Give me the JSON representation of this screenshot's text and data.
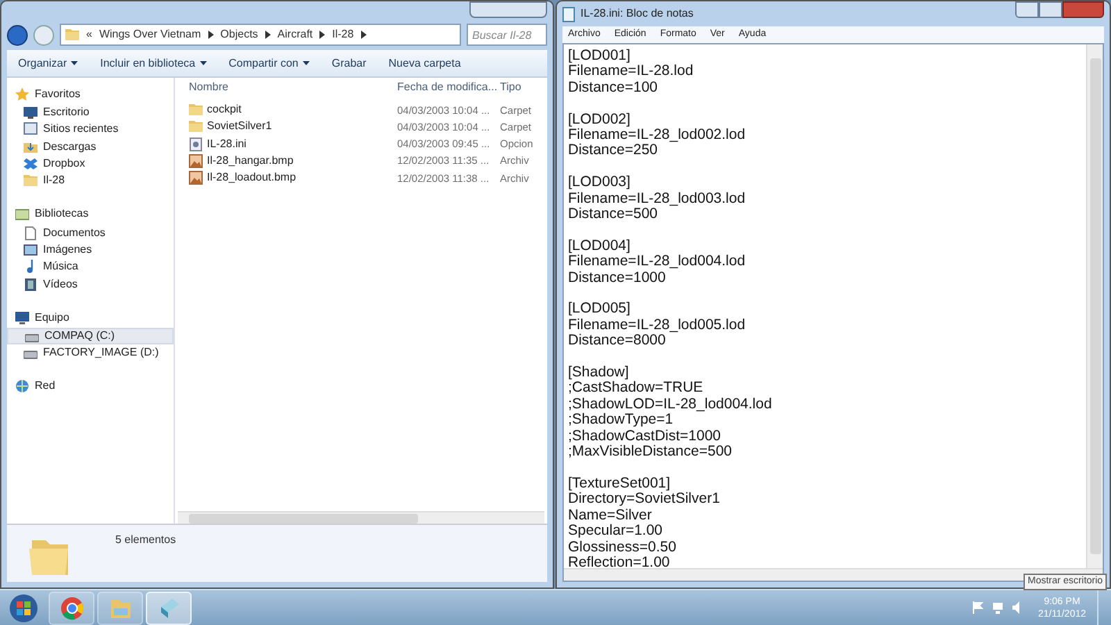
{
  "explorer": {
    "breadcrumb": [
      "«",
      "Wings Over Vietnam",
      "Objects",
      "Aircraft",
      "Il-28"
    ],
    "search": {
      "placeholder": "Buscar Il-28"
    },
    "toolbar": [
      {
        "label": "Organizar",
        "menu": true
      },
      {
        "label": "Incluir en biblioteca",
        "menu": true
      },
      {
        "label": "Compartir con",
        "menu": true
      },
      {
        "label": "Grabar",
        "menu": false
      },
      {
        "label": "Nueva carpeta",
        "menu": false
      }
    ],
    "sidebar": [
      {
        "label": "Favoritos",
        "kind": "star",
        "children": [
          {
            "label": "Escritorio",
            "kind": "desktop",
            "selected": false
          },
          {
            "label": "Sitios recientes",
            "kind": "recent",
            "selected": false
          },
          {
            "label": "Descargas",
            "kind": "download",
            "selected": false
          },
          {
            "label": "Dropbox",
            "kind": "dropbox",
            "selected": false
          },
          {
            "label": "Il-28",
            "kind": "folder",
            "selected": false
          }
        ]
      },
      {
        "label": "Bibliotecas",
        "kind": "library",
        "children": [
          {
            "label": "Documentos",
            "kind": "document",
            "selected": false
          },
          {
            "label": "Imágenes",
            "kind": "image",
            "selected": false
          },
          {
            "label": "Música",
            "kind": "music",
            "selected": false
          },
          {
            "label": "Vídeos",
            "kind": "video",
            "selected": false
          }
        ]
      },
      {
        "label": "Equipo",
        "kind": "computer",
        "children": [
          {
            "label": "COMPAQ (C:)",
            "kind": "drive",
            "selected": true
          },
          {
            "label": "FACTORY_IMAGE (D:)",
            "kind": "drive",
            "selected": false
          }
        ]
      },
      {
        "label": "Red",
        "kind": "network"
      }
    ],
    "columns": [
      "Nombre",
      "Fecha de modifica...",
      "Tipo"
    ],
    "files": [
      {
        "name": "cockpit",
        "kind": "folder",
        "date": "04/03/2003 10:04 ...",
        "type": "Carpet"
      },
      {
        "name": "SovietSilver1",
        "kind": "folder",
        "date": "04/03/2003 10:04 ...",
        "type": "Carpet"
      },
      {
        "name": "IL-28.ini",
        "kind": "ini",
        "date": "04/03/2003 09:45 ...",
        "type": "Opcion"
      },
      {
        "name": "Il-28_hangar.bmp",
        "kind": "bmp",
        "date": "12/02/2003 11:35 ...",
        "type": "Archiv"
      },
      {
        "name": "Il-28_loadout.bmp",
        "kind": "bmp",
        "date": "12/02/2003 11:38 ...",
        "type": "Archiv"
      }
    ],
    "status": "5 elementos"
  },
  "notepad": {
    "title": "IL-28.ini: Bloc de notas",
    "menu": [
      "Archivo",
      "Edición",
      "Formato",
      "Ver",
      "Ayuda"
    ],
    "paragraphs": [
      [
        "[LOD001]",
        "Filename=IL-28.lod",
        "Distance=100"
      ],
      [
        "[LOD002]",
        "Filename=IL-28_lod002.lod",
        "Distance=250"
      ],
      [
        "[LOD003]",
        "Filename=IL-28_lod003.lod",
        "Distance=500"
      ],
      [
        "[LOD004]",
        "Filename=IL-28_lod004.lod",
        "Distance=1000"
      ],
      [
        "[LOD005]",
        "Filename=IL-28_lod005.lod",
        "Distance=8000"
      ],
      [
        "[Shadow]",
        ";CastShadow=TRUE",
        ";ShadowLOD=IL-28_lod004.lod",
        ";ShadowType=1",
        ";ShadowCastDist=1000",
        ";MaxVisibleDistance=500"
      ],
      [
        "[TextureSet001]",
        "Directory=SovietSilver1",
        "Name=Silver",
        "Specular=1.00",
        "Glossiness=0.50",
        "Reflection=1.00"
      ]
    ]
  },
  "tooltip": "Mostrar escritorio",
  "taskbar": {
    "apps": [
      {
        "kind": "chrome",
        "selected": false
      },
      {
        "kind": "explorer",
        "selected": false
      },
      {
        "kind": "notepad",
        "selected": true
      }
    ],
    "time": "9:06 PM",
    "date": "21/11/2012"
  }
}
